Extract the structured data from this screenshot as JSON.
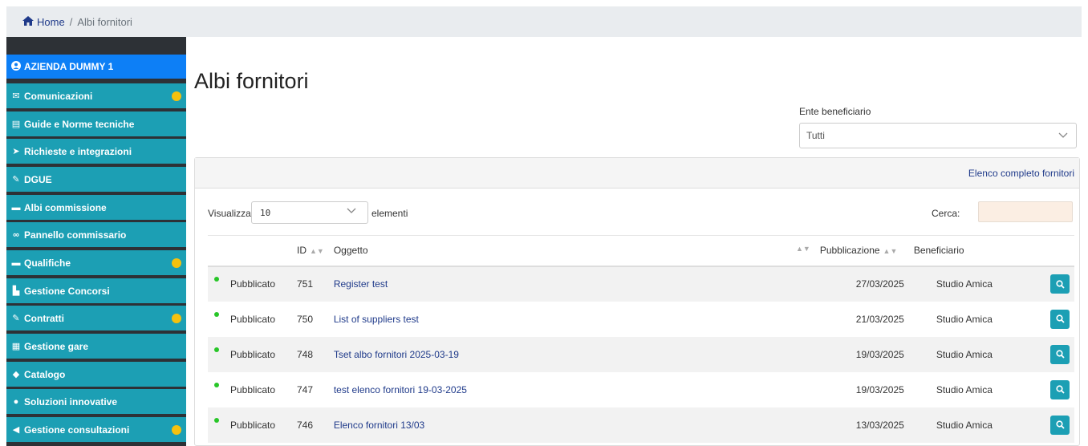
{
  "breadcrumb": {
    "home": "Home",
    "sep": "/",
    "current": "Albi fornitori"
  },
  "sidebar": {
    "company": "AZIENDA DUMMY 1",
    "items": [
      {
        "label": "Comunicazioni",
        "icon": "envelope-icon",
        "dot": true
      },
      {
        "label": "Guide e Norme tecniche",
        "icon": "file-icon",
        "dot": false
      },
      {
        "label": "Richieste e integrazioni",
        "icon": "paper-plane-icon",
        "dot": false
      },
      {
        "label": "DGUE",
        "icon": "edit-icon",
        "dot": false
      },
      {
        "label": "Albi commissione",
        "icon": "folder-open-icon",
        "dot": false
      },
      {
        "label": "Pannello commissario",
        "icon": "glasses-icon",
        "dot": false
      },
      {
        "label": "Qualifiche",
        "icon": "folder-open-icon",
        "dot": true
      },
      {
        "label": "Gestione Concorsi",
        "icon": "chart-icon",
        "dot": false
      },
      {
        "label": "Contratti",
        "icon": "pencil-square-icon",
        "dot": true
      },
      {
        "label": "Gestione gare",
        "icon": "briefcase-icon",
        "dot": false
      },
      {
        "label": "Catalogo",
        "icon": "tags-icon",
        "dot": false
      },
      {
        "label": "Soluzioni innovative",
        "icon": "lightbulb-icon",
        "dot": false
      },
      {
        "label": "Gestione consultazioni",
        "icon": "bullhorn-icon",
        "dot": true
      }
    ],
    "dot_color": "#f5c10e",
    "item_color": "#1c9fb4",
    "company_color": "#0d7ff6"
  },
  "main": {
    "title": "Albi fornitori",
    "filter_label": "Ente beneficiario",
    "filter_value": "Tutti",
    "panel_link": "Elenco completo fornitori",
    "show_label": "Visualizza",
    "page_length": "10",
    "elements_label": "elementi",
    "search_label": "Cerca:",
    "table": {
      "headers": [
        "",
        "ID",
        "Oggetto",
        "Pubblicazione",
        "Beneficiario",
        ""
      ],
      "rows": [
        {
          "status": "Pubblicato",
          "id": "751",
          "oggetto": "Register test",
          "pubblicazione": "27/03/2025",
          "beneficiario": "Studio Amica"
        },
        {
          "status": "Pubblicato",
          "id": "750",
          "oggetto": "List of suppliers test",
          "pubblicazione": "21/03/2025",
          "beneficiario": "Studio Amica"
        },
        {
          "status": "Pubblicato",
          "id": "748",
          "oggetto": "Tset albo fornitori 2025-03-19",
          "pubblicazione": "19/03/2025",
          "beneficiario": "Studio Amica"
        },
        {
          "status": "Pubblicato",
          "id": "747",
          "oggetto": "test elenco fornitori 19-03-2025",
          "pubblicazione": "19/03/2025",
          "beneficiario": "Studio Amica"
        },
        {
          "status": "Pubblicato",
          "id": "746",
          "oggetto": "Elenco fornitori 13/03",
          "pubblicazione": "13/03/2025",
          "beneficiario": "Studio Amica"
        }
      ]
    },
    "status_color": "#28c628",
    "row_action_icon": "search-icon"
  }
}
